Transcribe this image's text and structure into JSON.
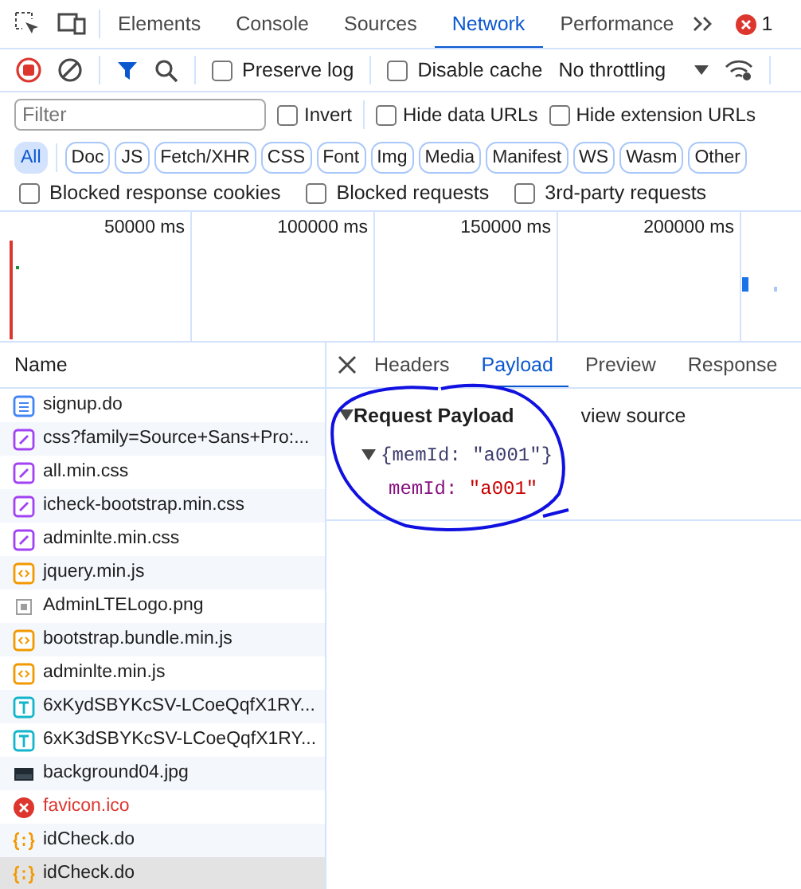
{
  "main_tabs": [
    {
      "label": "Elements",
      "selected": false
    },
    {
      "label": "Console",
      "selected": false
    },
    {
      "label": "Sources",
      "selected": false
    },
    {
      "label": "Network",
      "selected": true
    },
    {
      "label": "Performance",
      "selected": false
    }
  ],
  "error_count": "1",
  "toolbar": {
    "recording": true,
    "preserve_log": {
      "label": "Preserve log",
      "checked": false
    },
    "disable_cache": {
      "label": "Disable cache",
      "checked": false
    },
    "throttling": "No throttling"
  },
  "filter": {
    "placeholder": "Filter",
    "options": [
      {
        "label": "Invert",
        "checked": false
      },
      {
        "label": "Hide data URLs",
        "checked": false
      },
      {
        "label": "Hide extension URLs",
        "checked": false
      }
    ]
  },
  "type_filters": [
    {
      "label": "All",
      "selected": true
    },
    {
      "label": "Doc",
      "selected": false
    },
    {
      "label": "JS",
      "selected": false
    },
    {
      "label": "Fetch/XHR",
      "selected": false
    },
    {
      "label": "CSS",
      "selected": false
    },
    {
      "label": "Font",
      "selected": false
    },
    {
      "label": "Img",
      "selected": false
    },
    {
      "label": "Media",
      "selected": false
    },
    {
      "label": "Manifest",
      "selected": false
    },
    {
      "label": "WS",
      "selected": false
    },
    {
      "label": "Wasm",
      "selected": false
    },
    {
      "label": "Other",
      "selected": false
    }
  ],
  "blocked_filters": [
    {
      "label": "Blocked response cookies",
      "checked": false
    },
    {
      "label": "Blocked requests",
      "checked": false
    },
    {
      "label": "3rd-party requests",
      "checked": false
    }
  ],
  "overview": {
    "ticks": [
      "50000 ms",
      "100000 ms",
      "150000 ms",
      "200000 ms"
    ]
  },
  "requests": {
    "column": "Name",
    "rows": [
      {
        "name": "signup.do",
        "kind": "document",
        "selected": false
      },
      {
        "name": "css?family=Source+Sans+Pro:...",
        "kind": "stylesheet",
        "selected": false
      },
      {
        "name": "all.min.css",
        "kind": "stylesheet",
        "selected": false
      },
      {
        "name": "icheck-bootstrap.min.css",
        "kind": "stylesheet",
        "selected": false
      },
      {
        "name": "adminlte.min.css",
        "kind": "stylesheet",
        "selected": false
      },
      {
        "name": "jquery.min.js",
        "kind": "script",
        "selected": false
      },
      {
        "name": "AdminLTELogo.png",
        "kind": "image",
        "selected": false
      },
      {
        "name": "bootstrap.bundle.min.js",
        "kind": "script",
        "selected": false
      },
      {
        "name": "adminlte.min.js",
        "kind": "script",
        "selected": false
      },
      {
        "name": "6xKydSBYKcSV-LCoeQqfX1RY...",
        "kind": "font",
        "selected": false
      },
      {
        "name": "6xK3dSBYKcSV-LCoeQqfX1RY...",
        "kind": "font",
        "selected": false
      },
      {
        "name": "background04.jpg",
        "kind": "thumbnail",
        "selected": false
      },
      {
        "name": "favicon.ico",
        "kind": "error",
        "selected": false
      },
      {
        "name": "idCheck.do",
        "kind": "fetch",
        "selected": false
      },
      {
        "name": "idCheck.do",
        "kind": "fetch",
        "selected": true
      }
    ]
  },
  "details": {
    "tabs": [
      {
        "label": "Headers",
        "selected": false
      },
      {
        "label": "Payload",
        "selected": true
      },
      {
        "label": "Preview",
        "selected": false
      },
      {
        "label": "Response",
        "selected": false
      }
    ],
    "payload": {
      "title": "Request Payload",
      "expanded": true,
      "view_source": "view source",
      "object": {
        "summary": "{memId: \"a001\"}",
        "expanded": true,
        "key": "memId:",
        "value": "\"a001\""
      }
    }
  }
}
